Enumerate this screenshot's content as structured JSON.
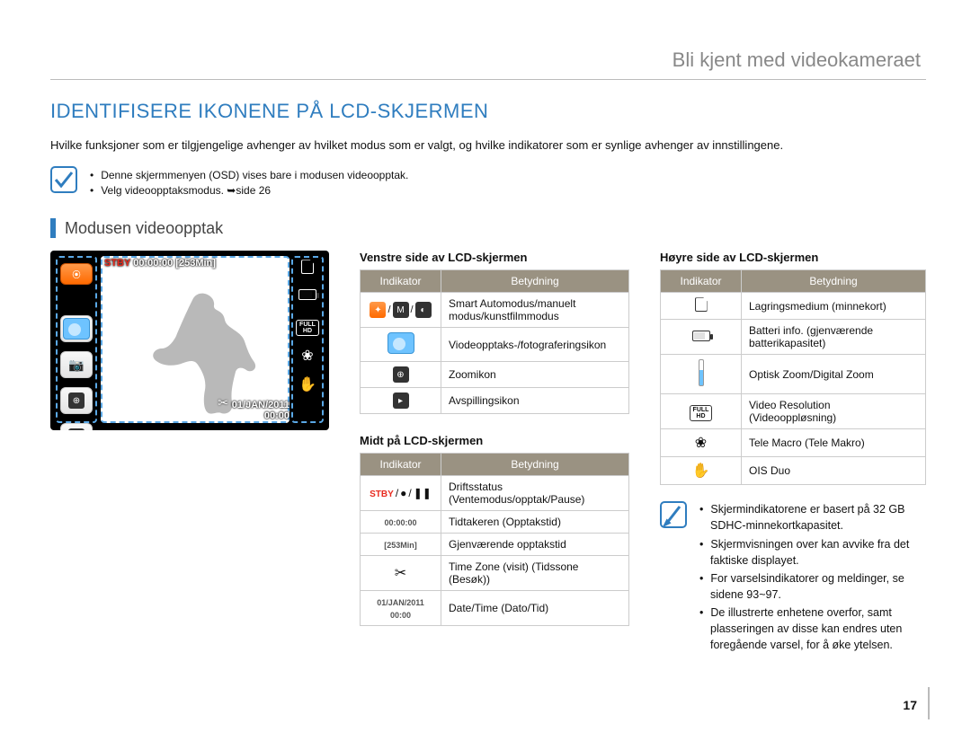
{
  "breadcrumb": "Bli kjent med videokameraet",
  "h1": "IDENTIFISERE IKONENE PÅ LCD-SKJERMEN",
  "intro": "Hvilke funksjoner som er tilgjengelige avhenger av hvilket modus som er valgt, og hvilke indikatorer som er synlige avhenger av innstillingene.",
  "top_notes": [
    "Denne skjermmenyen (OSD) vises bare i modusen videoopptak.",
    "Velg videoopptaksmodus. ➥side 26"
  ],
  "section_title": "Modusen videoopptak",
  "lcd": {
    "stby": "STBY",
    "timer": "00:00:00",
    "remain": "[253Min]",
    "date": "01/JAN/2011",
    "time": "00:00"
  },
  "headers": {
    "ind": "Indikator",
    "mean": "Betydning"
  },
  "left_title": "Venstre side av LCD-skjermen",
  "left_rows": [
    {
      "mean": "Smart Automodus/manuelt modus/kunstfilmmodus"
    },
    {
      "mean": "Viodeopptaks-/fotograferingsikon"
    },
    {
      "mean": "Zoomikon"
    },
    {
      "mean": "Avspillingsikon"
    }
  ],
  "mid_title": "Midt på LCD-skjermen",
  "mid_rows": [
    {
      "ind_html": "stby",
      "mean": "Driftsstatus (Ventemodus/opptak/Pause)"
    },
    {
      "ind_text": "00:00:00",
      "mean": "Tidtakeren (Opptakstid)"
    },
    {
      "ind_text": "[253Min]",
      "mean": "Gjenværende opptakstid"
    },
    {
      "ind_html": "scissor",
      "mean": "Time Zone (visit) (Tidssone (Besøk))"
    },
    {
      "ind_text": "01/JAN/2011\n00:00",
      "mean": "Date/Time (Dato/Tid)"
    }
  ],
  "right_title": "Høyre side av LCD-skjermen",
  "right_rows": [
    {
      "icon": "sd",
      "mean": "Lagringsmedium (minnekort)"
    },
    {
      "icon": "batt",
      "mean": "Batteri info. (gjenværende batterikapasitet)"
    },
    {
      "icon": "zoom",
      "mean": "Optisk Zoom/Digital Zoom"
    },
    {
      "icon": "hd",
      "mean": "Video Resolution (Videooppløsning)"
    },
    {
      "icon": "flower",
      "mean": "Tele Macro (Tele Makro)"
    },
    {
      "icon": "hand",
      "mean": "OIS Duo"
    }
  ],
  "info_notes": [
    "Skjermindikatorene er basert på 32 GB SDHC-minnekortkapasitet.",
    "Skjermvisningen over kan avvike fra det faktiske displayet.",
    "For varselsindikatorer og meldinger, se sidene 93~97.",
    "De illustrerte enhetene overfor, samt plasseringen av disse kan endres uten foregående varsel, for å øke ytelsen."
  ],
  "page_no": "17"
}
